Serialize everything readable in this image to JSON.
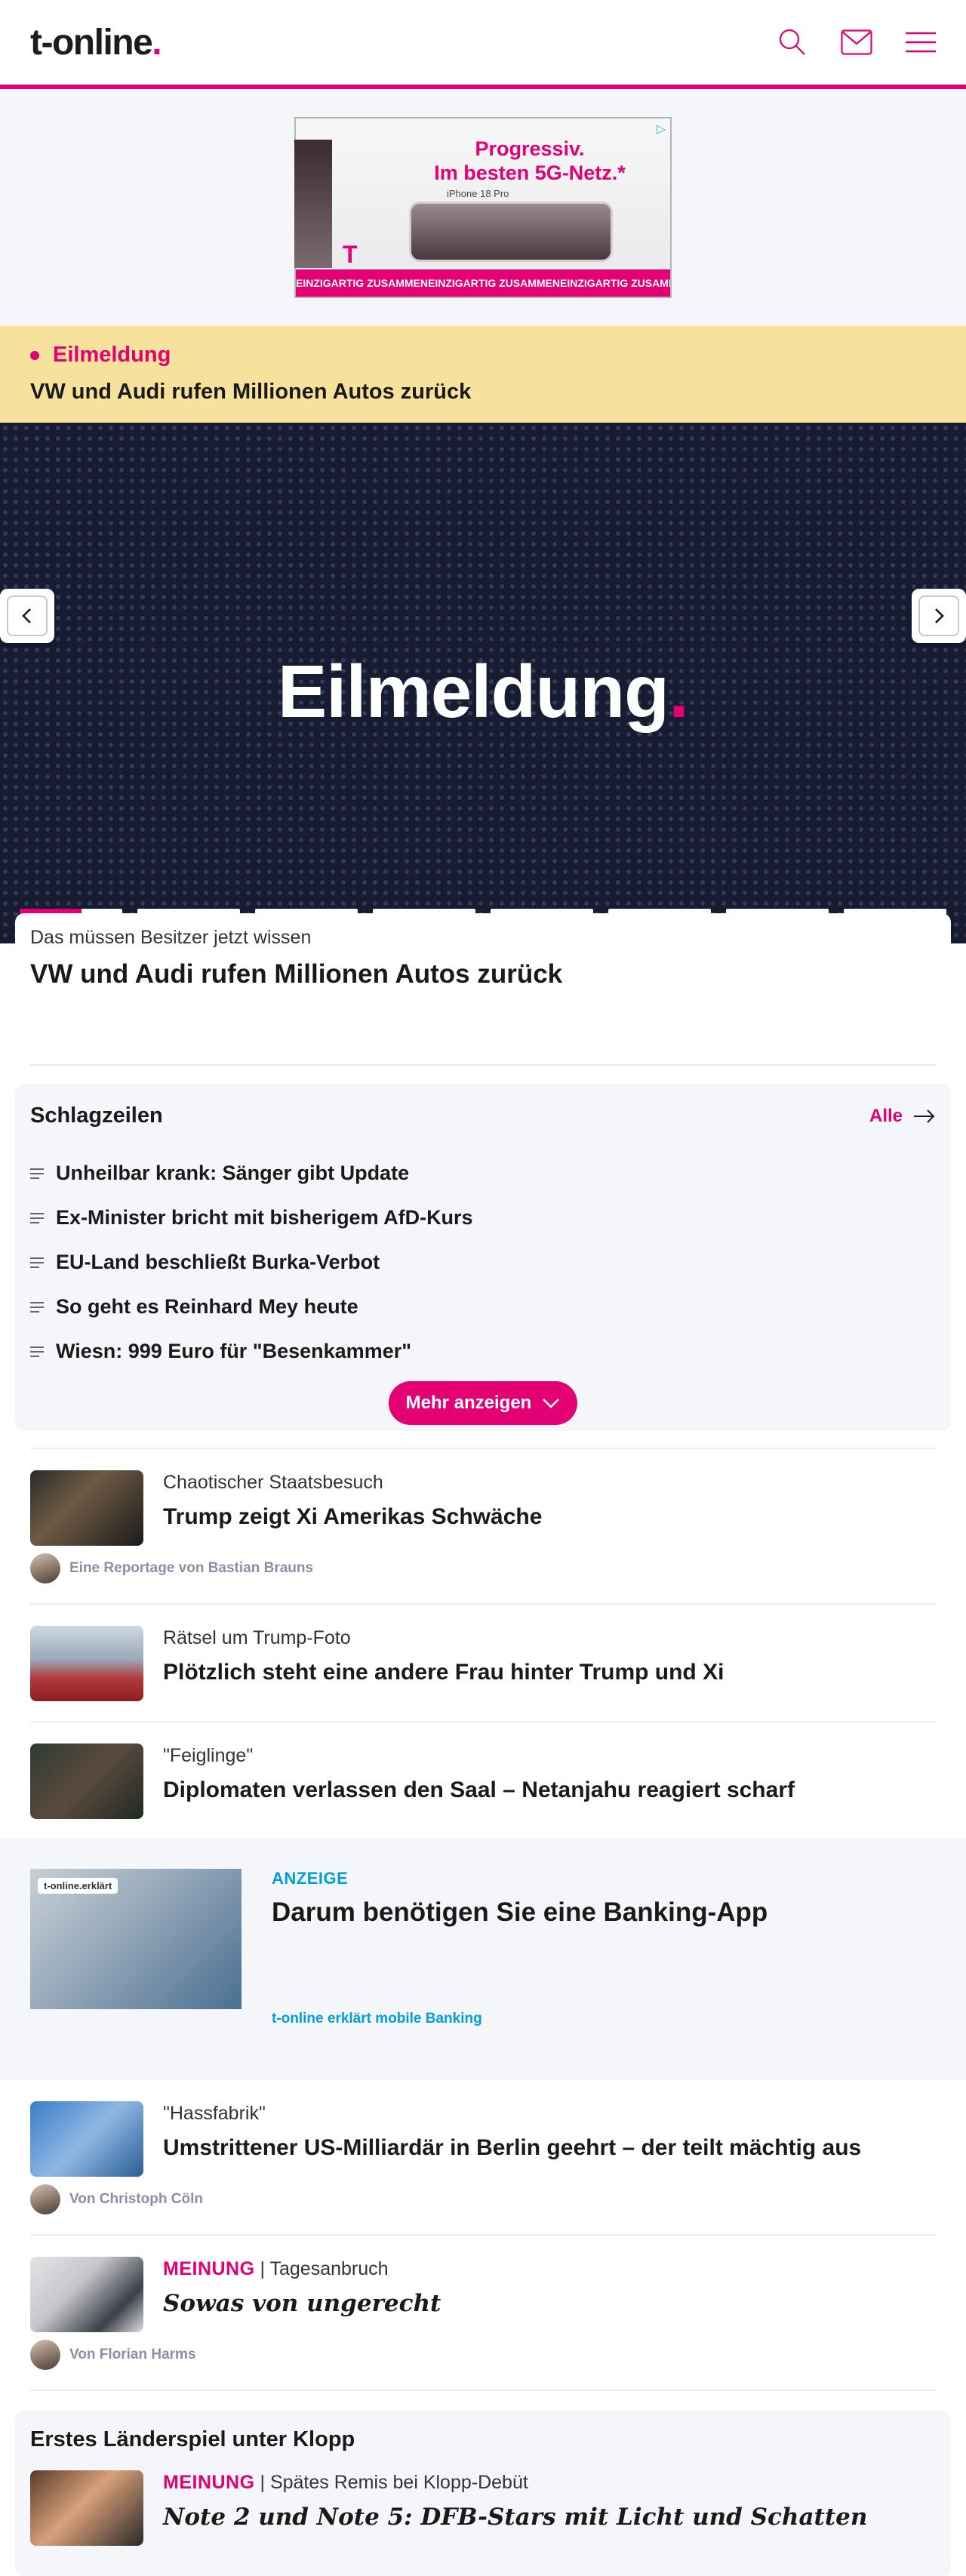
{
  "header": {
    "logo_text": "t-online",
    "logo_dot": ".",
    "icons": [
      "search-icon",
      "mail-icon",
      "menu-icon"
    ]
  },
  "ad_top": {
    "slogan_line1": "Progressiv.",
    "slogan_line2": "Im besten 5G-Netz.*",
    "phone_label": "iPhone 18 Pro",
    "band_text": "EINZIGARTIG ZUSAMMEN",
    "brand": "T"
  },
  "breaking": {
    "label": "Eilmeldung",
    "title": "VW und Audi rufen Millionen Autos zurück"
  },
  "hero": {
    "title": "Eilmeldung",
    "title_dot": ".",
    "slides_total": 8,
    "active_progress": 0.6
  },
  "hero_card": {
    "kicker": "Das müssen Besitzer jetzt wissen",
    "title": "VW und Audi rufen Millionen Autos zurück"
  },
  "headlines": {
    "title": "Schlagzeilen",
    "all_label": "Alle",
    "items": [
      "Unheilbar krank: Sänger gibt Update",
      "Ex-Minister bricht mit bisherigem AfD-Kurs",
      "EU-Land beschließt Burka-Verbot",
      "So geht es Reinhard Mey heute",
      "Wiesn: 999 Euro für \"Besenkammer\""
    ],
    "more_label": "Mehr anzeigen"
  },
  "articles": [
    {
      "kicker": "Chaotischer Staatsbesuch",
      "title": "Trump zeigt Xi Amerikas Schwäche",
      "author": "Eine Reportage von Bastian Brauns"
    },
    {
      "kicker": "Rätsel um Trump-Foto",
      "title": "Plötzlich steht eine andere Frau hinter Trump und Xi"
    },
    {
      "kicker": "\"Feiglinge\"",
      "title": "Diplomaten verlassen den Saal – Netanjahu reagiert scharf"
    }
  ],
  "sponsored": {
    "label": "ANZEIGE",
    "title": "Darum benötigen Sie eine Banking-App",
    "sub": "t-online erklärt mobile Banking",
    "image_tag": "t-online.erklärt"
  },
  "articles2": [
    {
      "kicker": "\"Hassfabrik\"",
      "title": "Umstrittener US-Milliardär in Berlin geehrt – der teilt mächtig aus",
      "author": "Von Christoph Cöln"
    },
    {
      "meinung": "MEINUNG",
      "kicker_rest": " | Tagesanbruch",
      "title": "Sowas von ungerecht",
      "author": "Von Florian Harms"
    }
  ],
  "section": {
    "title": "Erstes Länderspiel unter Klopp",
    "meinung": "MEINUNG",
    "kicker_rest": " | Spätes Remis bei Klopp-Debüt",
    "article_title": "Note 2 und Note 5: DFB-Stars mit Licht und Schatten"
  },
  "colors": {
    "accent": "#e20074",
    "breaking_bg": "#f6e29d",
    "hero_bg": "#171c33",
    "sponsored": "#00a0d6"
  }
}
